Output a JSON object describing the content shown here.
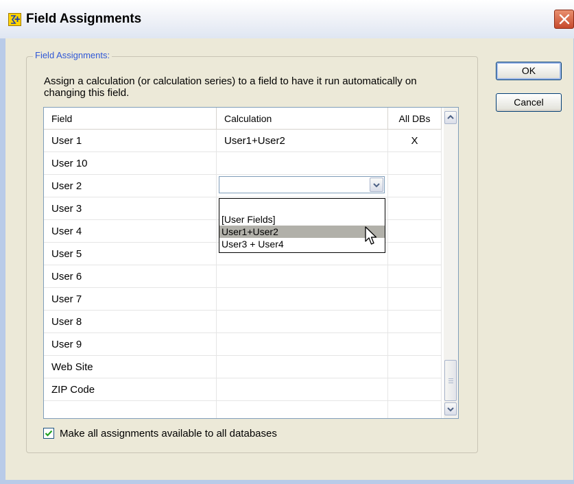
{
  "window": {
    "title": "Field Assignments",
    "icon": "sigma-plus-icon",
    "close_icon": "close-icon"
  },
  "group": {
    "label": "Field Assignments:",
    "description": "Assign a calculation (or calculation series) to a field to have it run automatically on changing this field."
  },
  "grid": {
    "columns": [
      "Field",
      "Calculation",
      "All DBs"
    ],
    "rows": [
      {
        "field": "User 1",
        "calculation": "User1+User2",
        "all_dbs": "X"
      },
      {
        "field": "User 10",
        "calculation": "",
        "all_dbs": ""
      },
      {
        "field": "User 2",
        "calculation": "",
        "all_dbs": ""
      },
      {
        "field": "User 3",
        "calculation": "",
        "all_dbs": ""
      },
      {
        "field": "User 4",
        "calculation": "",
        "all_dbs": ""
      },
      {
        "field": "User 5",
        "calculation": "",
        "all_dbs": ""
      },
      {
        "field": "User 6",
        "calculation": "",
        "all_dbs": ""
      },
      {
        "field": "User 7",
        "calculation": "",
        "all_dbs": ""
      },
      {
        "field": "User 8",
        "calculation": "",
        "all_dbs": ""
      },
      {
        "field": "User 9",
        "calculation": "",
        "all_dbs": ""
      },
      {
        "field": "Web Site",
        "calculation": "",
        "all_dbs": ""
      },
      {
        "field": "ZIP Code",
        "calculation": "",
        "all_dbs": ""
      },
      {
        "field": "",
        "calculation": "",
        "all_dbs": ""
      }
    ]
  },
  "dropdown": {
    "value": "",
    "options": [
      "",
      "[User Fields]",
      "User1+User2",
      "User3 + User4"
    ],
    "selected_index": 2
  },
  "checkbox": {
    "label": "Make all assignments available to all databases",
    "checked": true
  },
  "buttons": {
    "ok": "OK",
    "cancel": "Cancel"
  },
  "colors": {
    "dialog_bg": "#ece9d8",
    "group_label": "#2f57d6",
    "selection": "#b1b0a9",
    "close_button": "#c64a2d"
  }
}
